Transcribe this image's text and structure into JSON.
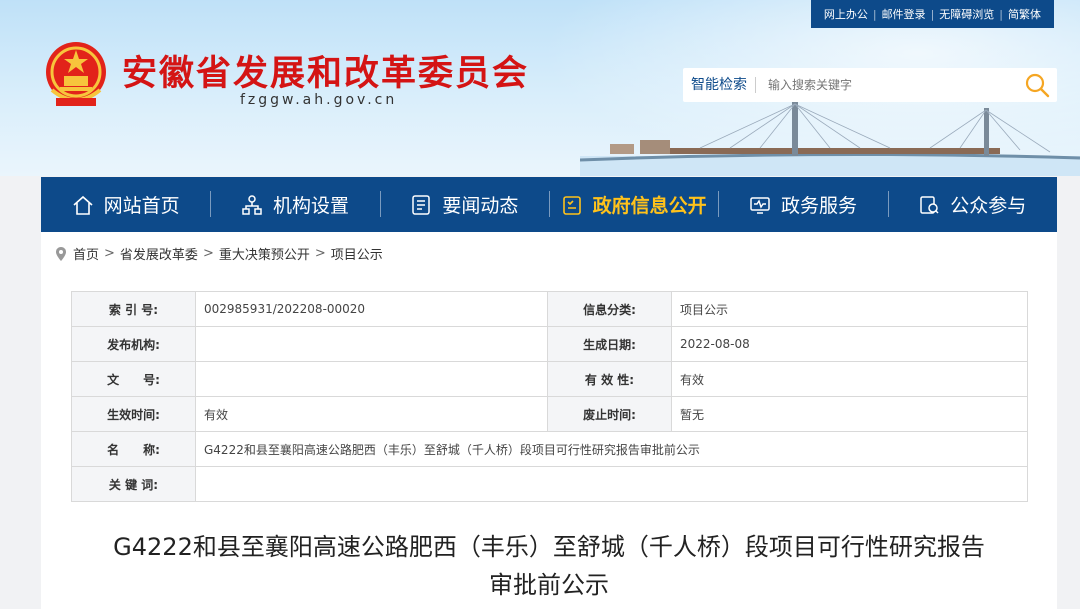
{
  "header": {
    "title": "安徽省发展和改革委员会",
    "domain": "fzggw.ah.gov.cn",
    "top_links": [
      "网上办公",
      "邮件登录",
      "无障碍浏览",
      "简繁体"
    ],
    "search_label": "智能检索",
    "search_placeholder": "输入搜索关键字"
  },
  "nav": {
    "items": [
      {
        "label": "网站首页",
        "icon": "home-icon"
      },
      {
        "label": "机构设置",
        "icon": "org-chart-icon"
      },
      {
        "label": "要闻动态",
        "icon": "news-icon"
      },
      {
        "label": "政府信息公开",
        "icon": "info-disclosure-icon"
      },
      {
        "label": "政务服务",
        "icon": "monitor-icon"
      },
      {
        "label": "公众参与",
        "icon": "public-participation-icon"
      }
    ],
    "active_color": "#ffc21b",
    "bar_color": "#0d4a8a"
  },
  "breadcrumb": [
    "首页",
    "省发展改革委",
    "重大决策预公开",
    "项目公示"
  ],
  "meta": {
    "index_label": "索 引 号:",
    "index_value": "002985931/202208-00020",
    "category_label": "信息分类:",
    "category_value": "项目公示",
    "publisher_label": "发布机构:",
    "publisher_value": "",
    "date_label": "生成日期:",
    "date_value": "2022-08-08",
    "docno_label": "文　　号:",
    "docno_value": "",
    "validity_label": "有 效 性:",
    "validity_value": "有效",
    "effective_label": "生效时间:",
    "effective_value": "有效",
    "repeal_label": "废止时间:",
    "repeal_value": "暂无",
    "name_label": "名　　称:",
    "name_value": "G4222和县至襄阳高速公路肥西（丰乐）至舒城（千人桥）段项目可行性研究报告审批前公示",
    "keywords_label": "关 键 词:",
    "keywords_value": ""
  },
  "doc_title_line1": "G4222和县至襄阳高速公路肥西（丰乐）至舒城（千人桥）段项目可行性研究报告",
  "doc_title_line2": "审批前公示",
  "colors": {
    "title_red": "#d41414",
    "brand_blue": "#0d4a8a",
    "search_icon": "#f5a623"
  }
}
